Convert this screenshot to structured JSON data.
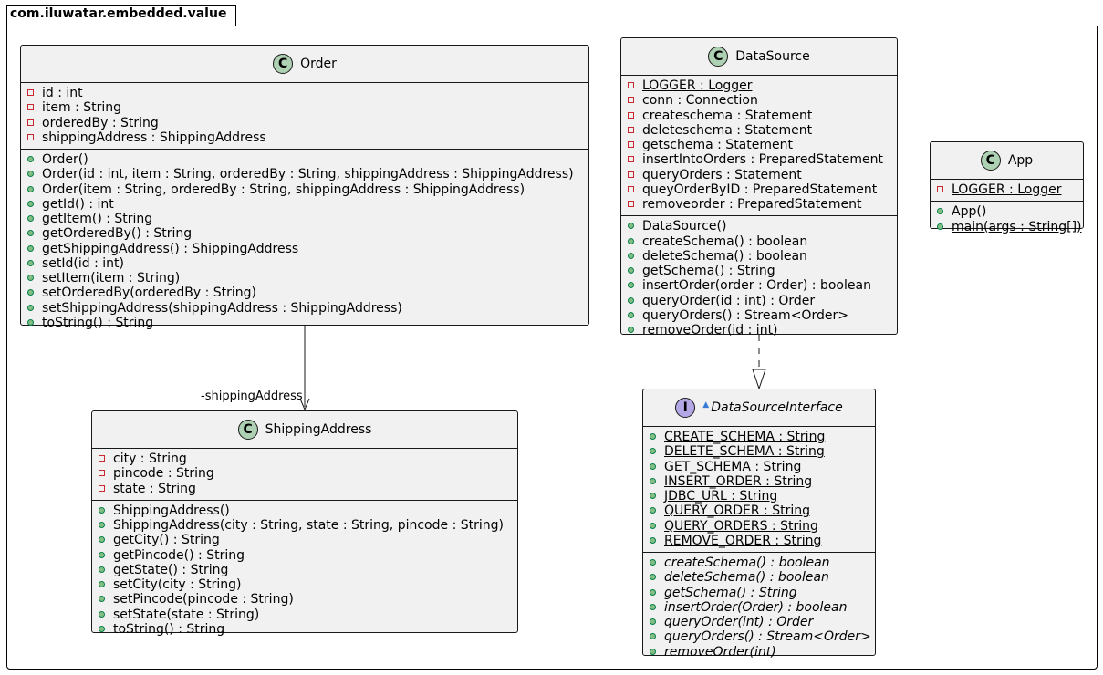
{
  "package": {
    "name": "com.iluwatar.embedded.value"
  },
  "classes": {
    "order": {
      "stereotype": "C",
      "name": "Order",
      "fields": [
        {
          "vis": "private",
          "text": "id : int"
        },
        {
          "vis": "private",
          "text": "item : String"
        },
        {
          "vis": "private",
          "text": "orderedBy : String"
        },
        {
          "vis": "private",
          "text": "shippingAddress : ShippingAddress"
        }
      ],
      "methods": [
        {
          "vis": "public",
          "text": "Order()"
        },
        {
          "vis": "public",
          "text": "Order(id : int, item : String, orderedBy : String, shippingAddress : ShippingAddress)"
        },
        {
          "vis": "public",
          "text": "Order(item : String, orderedBy : String, shippingAddress : ShippingAddress)"
        },
        {
          "vis": "public",
          "text": "getId() : int"
        },
        {
          "vis": "public",
          "text": "getItem() : String"
        },
        {
          "vis": "public",
          "text": "getOrderedBy() : String"
        },
        {
          "vis": "public",
          "text": "getShippingAddress() : ShippingAddress"
        },
        {
          "vis": "public",
          "text": "setId(id : int)"
        },
        {
          "vis": "public",
          "text": "setItem(item : String)"
        },
        {
          "vis": "public",
          "text": "setOrderedBy(orderedBy : String)"
        },
        {
          "vis": "public",
          "text": "setShippingAddress(shippingAddress : ShippingAddress)"
        },
        {
          "vis": "public",
          "text": "toString() : String"
        }
      ]
    },
    "dataSource": {
      "stereotype": "C",
      "name": "DataSource",
      "fields": [
        {
          "vis": "private",
          "text": "LOGGER : Logger",
          "static": true
        },
        {
          "vis": "private",
          "text": "conn : Connection"
        },
        {
          "vis": "private",
          "text": "createschema : Statement"
        },
        {
          "vis": "private",
          "text": "deleteschema : Statement"
        },
        {
          "vis": "private",
          "text": "getschema : Statement"
        },
        {
          "vis": "private",
          "text": "insertIntoOrders : PreparedStatement"
        },
        {
          "vis": "private",
          "text": "queryOrders : Statement"
        },
        {
          "vis": "private",
          "text": "queyOrderByID : PreparedStatement"
        },
        {
          "vis": "private",
          "text": "removeorder : PreparedStatement"
        }
      ],
      "methods": [
        {
          "vis": "public",
          "text": "DataSource()"
        },
        {
          "vis": "public",
          "text": "createSchema() : boolean"
        },
        {
          "vis": "public",
          "text": "deleteSchema() : boolean"
        },
        {
          "vis": "public",
          "text": "getSchema() : String"
        },
        {
          "vis": "public",
          "text": "insertOrder(order : Order) : boolean"
        },
        {
          "vis": "public",
          "text": "queryOrder(id : int) : Order"
        },
        {
          "vis": "public",
          "text": "queryOrders() : Stream<Order>"
        },
        {
          "vis": "public",
          "text": "removeOrder(id : int)"
        }
      ]
    },
    "app": {
      "stereotype": "C",
      "name": "App",
      "fields": [
        {
          "vis": "private",
          "text": "LOGGER : Logger",
          "static": true
        }
      ],
      "methods": [
        {
          "vis": "public",
          "text": "App()"
        },
        {
          "vis": "public",
          "text": "main(args : String[])",
          "static": true
        }
      ]
    },
    "shippingAddress": {
      "stereotype": "C",
      "name": "ShippingAddress",
      "fields": [
        {
          "vis": "private",
          "text": "city : String"
        },
        {
          "vis": "private",
          "text": "pincode : String"
        },
        {
          "vis": "private",
          "text": "state : String"
        }
      ],
      "methods": [
        {
          "vis": "public",
          "text": "ShippingAddress()"
        },
        {
          "vis": "public",
          "text": "ShippingAddress(city : String, state : String, pincode : String)"
        },
        {
          "vis": "public",
          "text": "getCity() : String"
        },
        {
          "vis": "public",
          "text": "getPincode() : String"
        },
        {
          "vis": "public",
          "text": "getState() : String"
        },
        {
          "vis": "public",
          "text": "setCity(city : String)"
        },
        {
          "vis": "public",
          "text": "setPincode(pincode : String)"
        },
        {
          "vis": "public",
          "text": "setState(state : String)"
        },
        {
          "vis": "public",
          "text": "toString() : String"
        }
      ]
    },
    "dataSourceInterface": {
      "stereotype": "I",
      "name": "DataSourceInterface",
      "fields": [
        {
          "vis": "public",
          "text": "CREATE_SCHEMA : String",
          "static": true
        },
        {
          "vis": "public",
          "text": "DELETE_SCHEMA : String",
          "static": true
        },
        {
          "vis": "public",
          "text": "GET_SCHEMA : String",
          "static": true
        },
        {
          "vis": "public",
          "text": "INSERT_ORDER : String",
          "static": true
        },
        {
          "vis": "public",
          "text": "JDBC_URL : String",
          "static": true
        },
        {
          "vis": "public",
          "text": "QUERY_ORDER : String",
          "static": true
        },
        {
          "vis": "public",
          "text": "QUERY_ORDERS : String",
          "static": true
        },
        {
          "vis": "public",
          "text": "REMOVE_ORDER : String",
          "static": true
        }
      ],
      "methods": [
        {
          "vis": "public",
          "text": "createSchema() : boolean",
          "abstract": true
        },
        {
          "vis": "public",
          "text": "deleteSchema() : boolean",
          "abstract": true
        },
        {
          "vis": "public",
          "text": "getSchema() : String",
          "abstract": true
        },
        {
          "vis": "public",
          "text": "insertOrder(Order) : boolean",
          "abstract": true
        },
        {
          "vis": "public",
          "text": "queryOrder(int) : Order",
          "abstract": true
        },
        {
          "vis": "public",
          "text": "queryOrders() : Stream<Order>",
          "abstract": true
        },
        {
          "vis": "public",
          "text": "removeOrder(int)",
          "abstract": true
        }
      ]
    }
  },
  "relations": {
    "orderToShipping": {
      "label": "-shippingAddress"
    }
  },
  "colors": {
    "classFill": "#f1f1f1",
    "border": "#181818",
    "classStereo": "#add1b2",
    "interfaceStereo": "#b4a7e5",
    "private": "#c82930",
    "public": "#84be84"
  }
}
